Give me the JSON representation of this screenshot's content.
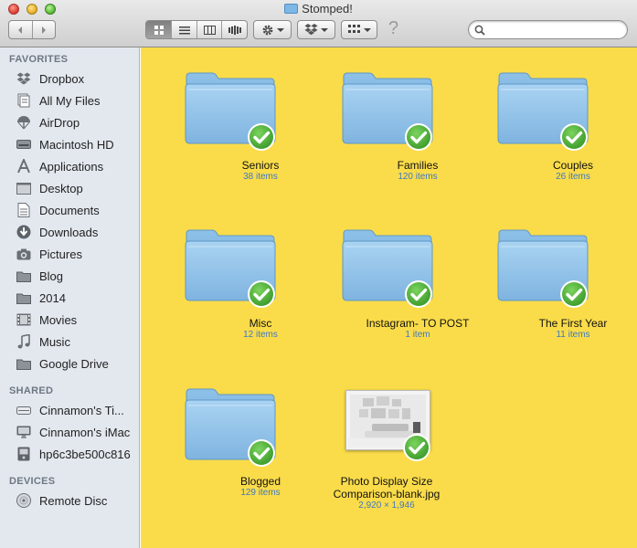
{
  "window": {
    "title": "Stomped!"
  },
  "toolbar": {
    "back_icon": "chevron-left-icon",
    "forward_icon": "chevron-right-icon",
    "view_modes": [
      "icon-view",
      "list-view",
      "column-view",
      "cover-flow-view"
    ],
    "action_icon": "gear-icon",
    "dropbox_icon": "dropbox-icon",
    "arrange_icon": "arrange-grid-icon",
    "help_label": "?",
    "search_placeholder": ""
  },
  "sidebar": {
    "favorites_header": "FAVORITES",
    "favorites": [
      {
        "label": "Dropbox",
        "icon": "dropbox-icon"
      },
      {
        "label": "All My Files",
        "icon": "all-files-icon"
      },
      {
        "label": "AirDrop",
        "icon": "airdrop-icon"
      },
      {
        "label": "Macintosh HD",
        "icon": "hard-drive-icon"
      },
      {
        "label": "Applications",
        "icon": "applications-icon"
      },
      {
        "label": "Desktop",
        "icon": "desktop-icon"
      },
      {
        "label": "Documents",
        "icon": "documents-icon"
      },
      {
        "label": "Downloads",
        "icon": "downloads-icon"
      },
      {
        "label": "Pictures",
        "icon": "camera-icon"
      },
      {
        "label": "Blog",
        "icon": "folder-icon"
      },
      {
        "label": "2014",
        "icon": "folder-icon"
      },
      {
        "label": "Movies",
        "icon": "film-icon"
      },
      {
        "label": "Music",
        "icon": "music-icon"
      },
      {
        "label": "Google Drive",
        "icon": "folder-icon"
      }
    ],
    "shared_header": "SHARED",
    "shared": [
      {
        "label": "Cinnamon's Ti...",
        "icon": "time-capsule-icon"
      },
      {
        "label": "Cinnamon's iMac",
        "icon": "imac-icon"
      },
      {
        "label": "hp6c3be500c816",
        "icon": "printer-icon"
      }
    ],
    "devices_header": "DEVICES",
    "devices": [
      {
        "label": "Remote Disc",
        "icon": "remote-disc-icon"
      }
    ]
  },
  "content": {
    "background": "#fadc4a",
    "items": [
      {
        "name": "Seniors",
        "detail": "38 items",
        "kind": "folder"
      },
      {
        "name": "Families",
        "detail": "120 items",
        "kind": "folder"
      },
      {
        "name": "Couples",
        "detail": "26 items",
        "kind": "folder"
      },
      {
        "name": "Misc",
        "detail": "12 items",
        "kind": "folder"
      },
      {
        "name": "Instagram- TO POST",
        "detail": "1 item",
        "kind": "folder"
      },
      {
        "name": "The First Year",
        "detail": "11 items",
        "kind": "folder"
      },
      {
        "name": "Blogged",
        "detail": "129 items",
        "kind": "folder"
      },
      {
        "name": "Photo Display Size",
        "name2": "Comparison-blank.jpg",
        "detail": "2,920 × 1,946",
        "kind": "image"
      }
    ],
    "sync_badge_icon": "synced-check-icon",
    "colors": {
      "folder": "#8fc3ea",
      "badge": "#4fae3a",
      "detail_text": "#3f78c2"
    }
  }
}
